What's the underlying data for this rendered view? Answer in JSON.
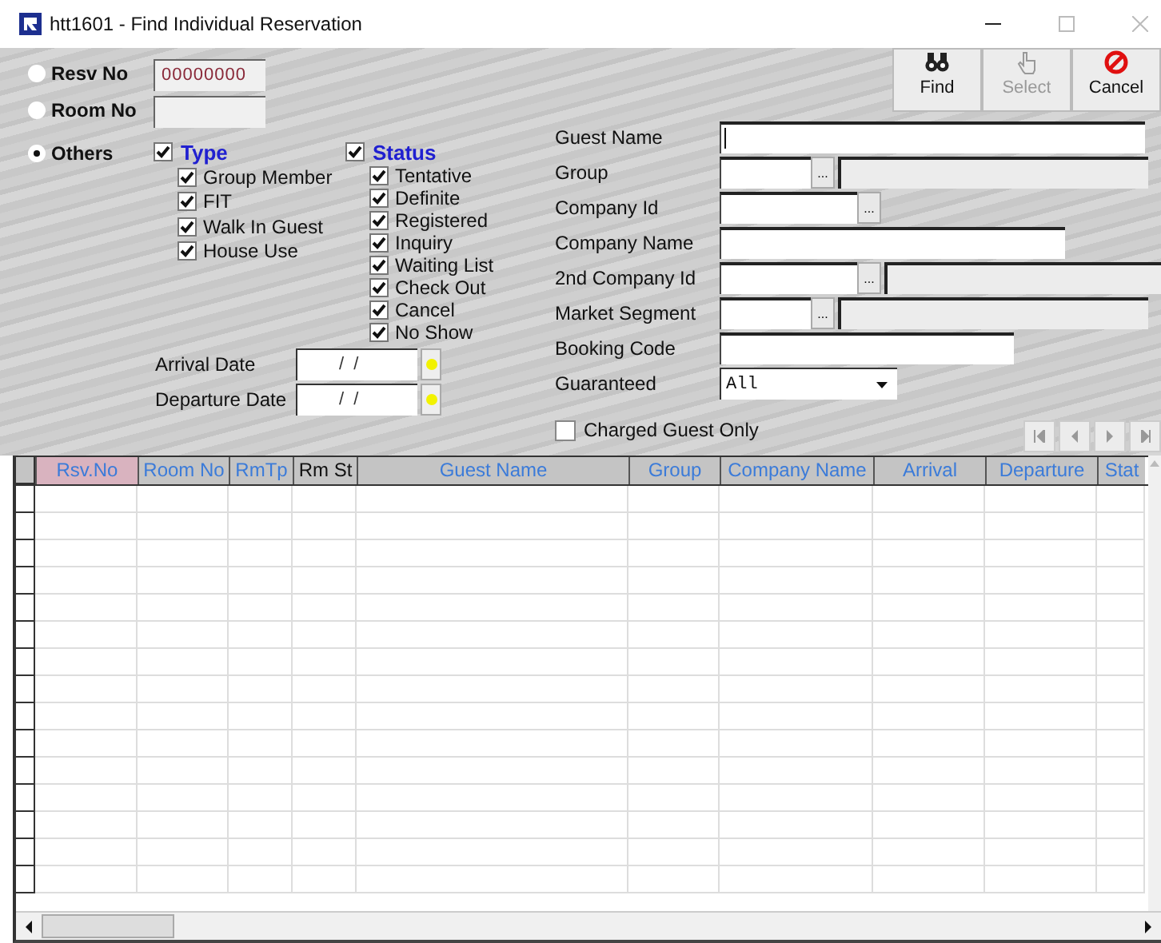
{
  "window": {
    "title": "htt1601 - Find Individual Reservation"
  },
  "search_modes": [
    {
      "label": "Resv No",
      "selected": false,
      "value": "00000000"
    },
    {
      "label": "Room No",
      "selected": false
    },
    {
      "label": "Others",
      "selected": true
    }
  ],
  "type_filter": {
    "label": "Type",
    "checked": true,
    "items": [
      {
        "label": "Group Member",
        "checked": true
      },
      {
        "label": "FIT",
        "checked": true
      },
      {
        "label": "Walk In Guest",
        "checked": true
      },
      {
        "label": "House Use",
        "checked": true
      }
    ]
  },
  "status_filter": {
    "label": "Status",
    "checked": true,
    "items": [
      {
        "label": "Tentative",
        "checked": true
      },
      {
        "label": "Definite",
        "checked": true
      },
      {
        "label": "Registered",
        "checked": true
      },
      {
        "label": "Inquiry",
        "checked": true
      },
      {
        "label": "Waiting List",
        "checked": true
      },
      {
        "label": "Check Out",
        "checked": true
      },
      {
        "label": "Cancel",
        "checked": true
      },
      {
        "label": "No Show",
        "checked": true
      }
    ]
  },
  "dates": [
    {
      "label": "Arrival Date",
      "value": "/  /"
    },
    {
      "label": "Departure Date",
      "value": "/  /"
    }
  ],
  "toolbar": [
    {
      "label": "Find",
      "kind": "find",
      "disabled": false
    },
    {
      "label": "Select",
      "kind": "select",
      "disabled": true
    },
    {
      "label": "Cancel",
      "kind": "cancel",
      "disabled": false
    }
  ],
  "fields": [
    {
      "label": "Guest Name",
      "kind": "text",
      "focused": true
    },
    {
      "label": "Group",
      "kind": "lookup",
      "button": "...",
      "description": true,
      "focused": false
    },
    {
      "label": "Company Id",
      "kind": "lookup",
      "button": "...",
      "description": false,
      "focused": false
    },
    {
      "label": "Company Name",
      "kind": "text",
      "focused": false
    },
    {
      "label": "2nd Company Id",
      "kind": "lookup",
      "button": "...",
      "description": true,
      "focused": false
    },
    {
      "label": "Market Segment",
      "kind": "lookup",
      "button": "...",
      "description": true,
      "focused": false
    },
    {
      "label": "Booking Code",
      "kind": "text",
      "focused": false
    },
    {
      "label": "Guaranteed",
      "kind": "select",
      "value": "All"
    }
  ],
  "charged_guest_only": {
    "label": "Charged Guest Only",
    "checked": false
  },
  "table": {
    "columns": [
      {
        "label": "Rsv.No",
        "sorted": true,
        "color": "#3b7bd9"
      },
      {
        "label": "Room No",
        "sorted": false,
        "color": "#3b7bd9"
      },
      {
        "label": "RmTp",
        "sorted": false,
        "color": "#3b7bd9"
      },
      {
        "label": "Rm St",
        "sorted": false,
        "color": "#111111"
      },
      {
        "label": "Guest Name",
        "sorted": false,
        "color": "#3b7bd9"
      },
      {
        "label": "Group",
        "sorted": false,
        "color": "#3b7bd9"
      },
      {
        "label": "Company Name",
        "sorted": false,
        "color": "#3b7bd9"
      },
      {
        "label": "Arrival",
        "sorted": false,
        "color": "#3b7bd9"
      },
      {
        "label": "Departure",
        "sorted": false,
        "color": "#3b7bd9"
      },
      {
        "label": "Stat",
        "sorted": false,
        "color": "#3b7bd9"
      }
    ]
  }
}
